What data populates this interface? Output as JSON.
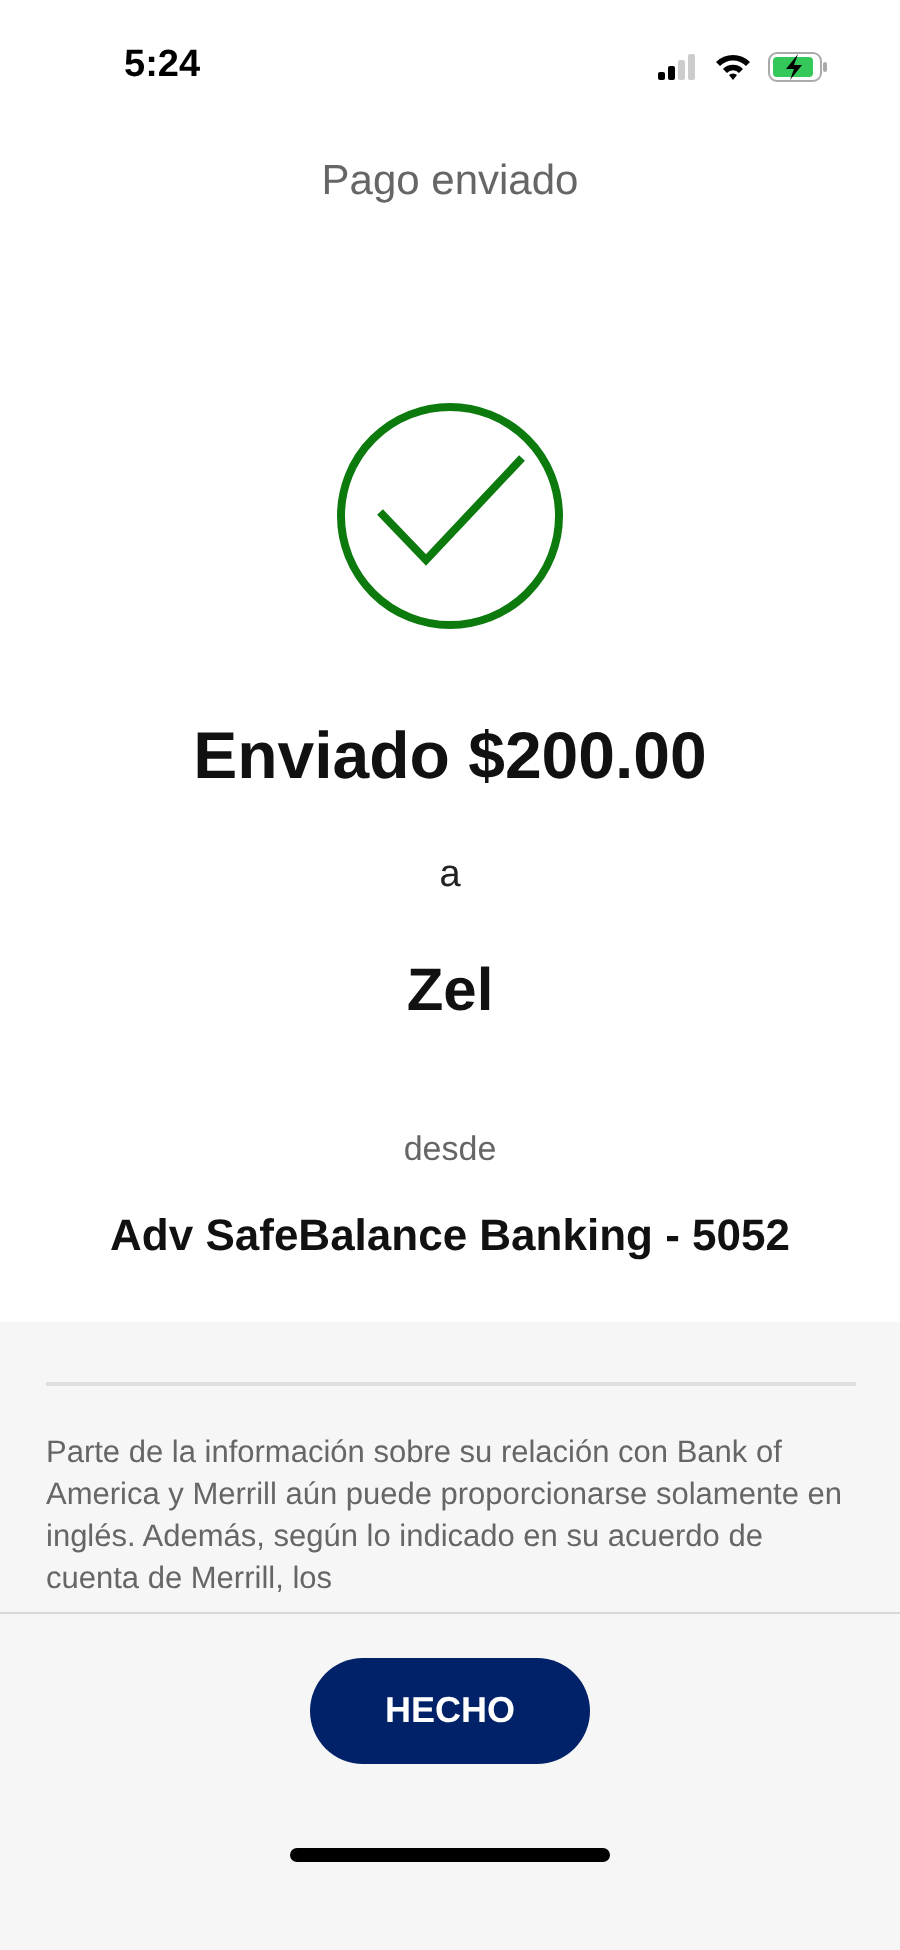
{
  "status_bar": {
    "time": "5:24"
  },
  "header": {
    "title": "Pago enviado"
  },
  "confirmation": {
    "amount_line": "Enviado $200.00",
    "to_label": "a",
    "recipient": "Zel",
    "from_label": "desde",
    "account": "Adv SafeBalance Banking - 5052"
  },
  "disclosure": {
    "text": "Parte de la información sobre su relación con Bank of America y Merrill aún puede proporcionarse solamente en inglés. Además, según lo indicado en su acuerdo de cuenta de Merrill, los"
  },
  "footer": {
    "button": "HECHO"
  }
}
